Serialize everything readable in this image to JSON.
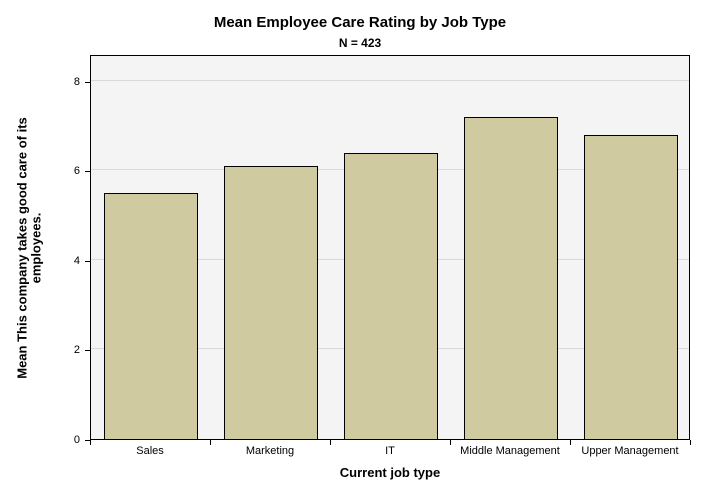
{
  "chart_data": {
    "type": "bar",
    "title": "Mean Employee Care Rating by Job Type",
    "subtitle": "N = 423",
    "xlabel": "Current job type",
    "ylabel_line1": "Mean This company takes good care of its",
    "ylabel_line2": "employees.",
    "categories": [
      "Sales",
      "Marketing",
      "IT",
      "Middle Management",
      "Upper Management"
    ],
    "values": [
      5.5,
      6.1,
      6.4,
      7.2,
      6.8
    ],
    "ylim": [
      0,
      8.6
    ],
    "yticks": [
      0,
      2,
      4,
      6,
      8
    ],
    "bar_color": "#d0caa0",
    "plot_bg": "#f4f4f4"
  }
}
